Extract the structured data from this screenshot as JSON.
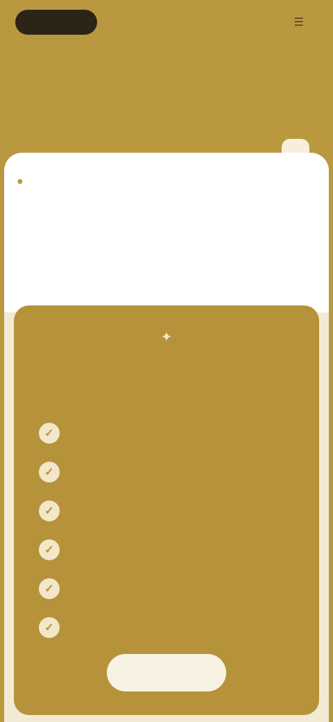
{
  "header": {
    "logo_text": "",
    "action_label": "",
    "title": "",
    "subtitle": ""
  },
  "info_chip": {
    "icon": "lightbulb-icon",
    "label": ""
  },
  "intro": {
    "title": "",
    "body": ""
  },
  "plan": {
    "top_icon": "sparkle-icon",
    "title": "",
    "features": [
      {
        "icon": "check-icon",
        "label": ""
      },
      {
        "icon": "check-icon",
        "label": ""
      },
      {
        "icon": "check-icon",
        "label": ""
      },
      {
        "icon": "check-icon",
        "label": ""
      },
      {
        "icon": "check-icon",
        "label": ""
      },
      {
        "icon": "check-icon",
        "label": ""
      }
    ],
    "cta_label": ""
  },
  "colors": {
    "brand_gold": "#b9983f",
    "card_gold": "#b6923a",
    "cream": "#f3ead5",
    "dark": "#2b2417"
  }
}
